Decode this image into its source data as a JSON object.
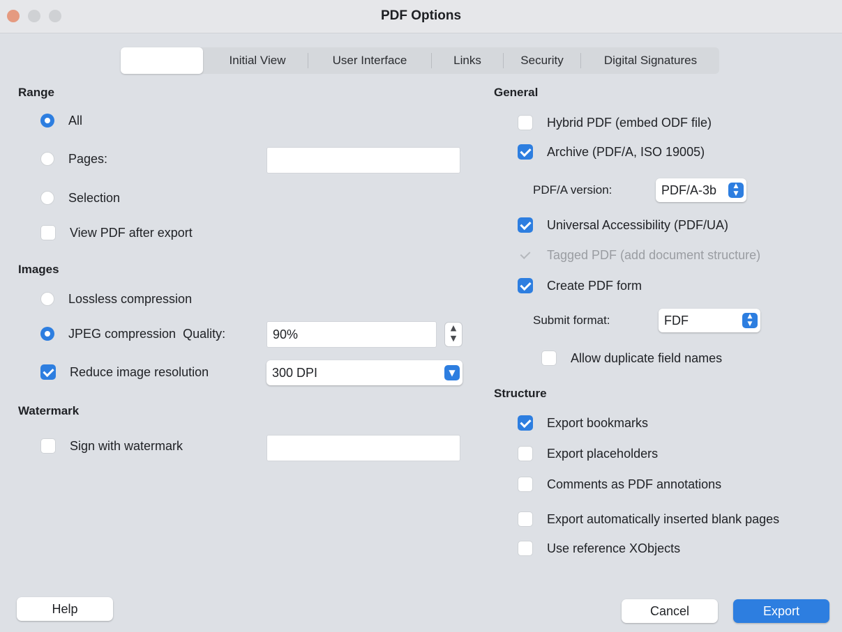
{
  "window": {
    "title": "PDF Options"
  },
  "tabs": [
    {
      "label": ""
    },
    {
      "label": "Initial View"
    },
    {
      "label": "User Interface"
    },
    {
      "label": "Links"
    },
    {
      "label": "Security"
    },
    {
      "label": "Digital Signatures"
    }
  ],
  "range": {
    "heading": "Range",
    "all_label": "All",
    "pages_label": "Pages:",
    "pages_value": "",
    "selection_label": "Selection",
    "view_after_label": "View PDF after export",
    "selected": "All"
  },
  "images": {
    "heading": "Images",
    "lossless_label": "Lossless compression",
    "jpeg_label": "JPEG compression",
    "quality_label": "Quality:",
    "quality_value": "90%",
    "reduce_label": "Reduce image resolution",
    "reduce_checked": true,
    "resolution_value": "300 DPI"
  },
  "watermark": {
    "heading": "Watermark",
    "sign_label": "Sign with watermark",
    "sign_value": ""
  },
  "general": {
    "heading": "General",
    "hybrid_label": "Hybrid PDF (embed ODF file)",
    "archive_label": "Archive (PDF/A, ISO 19005)",
    "pdfa_version_label": "PDF/A version:",
    "pdfa_version_value": "PDF/A-3b",
    "ua_label": "Universal Accessibility (PDF/UA)",
    "tagged_label": "Tagged PDF (add document structure)",
    "form_label": "Create PDF form",
    "submit_format_label": "Submit format:",
    "submit_format_value": "FDF",
    "allow_duplicates_label": "Allow duplicate field names"
  },
  "structure": {
    "heading": "Structure",
    "bookmarks_label": "Export bookmarks",
    "placeholders_label": "Export placeholders",
    "comments_label": "Comments as PDF annotations",
    "blank_pages_label": "Export automatically inserted blank pages",
    "xobjects_label": "Use reference XObjects"
  },
  "buttons": {
    "help": "Help",
    "cancel": "Cancel",
    "export": "Export"
  },
  "colors": {
    "accent": "#2d7ee0",
    "background": "#dde0e5"
  }
}
